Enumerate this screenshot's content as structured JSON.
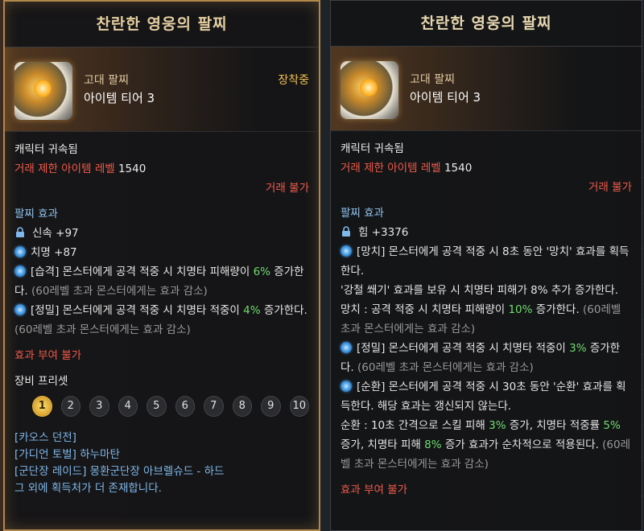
{
  "left": {
    "title": "찬란한 영웅의 팔찌",
    "grade": "고대 팔찌",
    "tier": "아이템 티어 3",
    "equipped": "장착중",
    "bound": "캐릭터 귀속됨",
    "trade_label": "거래 제한 아이템 레벨",
    "trade_level": "1540",
    "trade_status": "거래 불가",
    "section_title": "팔찌 효과",
    "stats": [
      {
        "icon": "lock-icon",
        "text": "신속 +97"
      },
      {
        "icon": "effect-orb-icon",
        "text": "치명 +87"
      }
    ],
    "effects": [
      {
        "tag": "[습격]",
        "text1": " 몬스터에게 공격 적중 시 치명타 피해량이 ",
        "val": "6%",
        "text2": " 증가한다.",
        "note": " (60레벨 초과 몬스터에게는 효과 감소)"
      },
      {
        "tag": "[정밀]",
        "text1": " 몬스터에게 공격 적중 시 치명타 적중이 ",
        "val": "4%",
        "text2": " 증가한다.",
        "note": " (60레벨 초과 몬스터에게는 효과 감소)"
      }
    ],
    "no_enhance": "효과 부여 불가",
    "preset_title": "장비 프리셋",
    "presets": [
      "1",
      "2",
      "3",
      "4",
      "5",
      "6",
      "7",
      "8",
      "9",
      "10"
    ],
    "sources": [
      "[카오스 던전]",
      "[가디언 토벌] 하누마탄",
      "[군단장 레이드] 몽환군단장 아브렐슈드 - 하드",
      "그 외에 획득처가 더 존재합니다."
    ]
  },
  "right": {
    "title": "찬란한 영웅의 팔찌",
    "grade": "고대 팔찌",
    "tier": "아이템 티어 3",
    "bound": "캐릭터 귀속됨",
    "trade_label": "거래 제한 아이템 레벨",
    "trade_level": "1540",
    "trade_status": "거래 불가",
    "section_title": "팔찌 효과",
    "stat": "힘 +3376",
    "e1_tag": "[망치]",
    "e1_text": " 몬스터에게 공격 적중 시 8초 동안 '망치' 효과를 획득한다.",
    "e1_line2": "'강철 쐐기' 효과를 보유 시 치명타 피해가 8% 추가 증가한다.",
    "e1_line3a": "망치 : 공격 적중 시 치명타 피해량이 ",
    "e1_val": "10%",
    "e1_line3b": " 증가한다.",
    "e1_note": " (60레벨 초과 몬스터에게는 효과 감소)",
    "e2_tag": "[정밀]",
    "e2_text": " 몬스터에게 공격 적중 시 치명타 적중이 ",
    "e2_val": "3%",
    "e2_text2": " 증가한다.",
    "e2_note": " (60레벨 초과 몬스터에게는 효과 감소)",
    "e3_tag": "[순환]",
    "e3_text": " 몬스터에게 공격 적중 시 30초 동안 '순환' 효과를 획득한다. 해당 효과는 갱신되지 않는다.",
    "e3_l2a": "순환 : 10초 간격으로 스킬 피해 ",
    "e3_v1": "3%",
    "e3_l2b": " 증가, 치명타 적중률 ",
    "e3_v2": "5%",
    "e3_l2c": " 증가, 치명타 피해 ",
    "e3_v3": "8%",
    "e3_l2d": " 증가 효과가 순차적으로 적용된다.",
    "e3_note": " (60레벨 초과 몬스터에게는 효과 감소)",
    "no_enhance": "효과 부여 불가"
  },
  "colors": {
    "accent_gold": "#b2884a",
    "red": "#ef5a4a",
    "blue": "#8fc3ee",
    "green": "#6fdc6f"
  }
}
